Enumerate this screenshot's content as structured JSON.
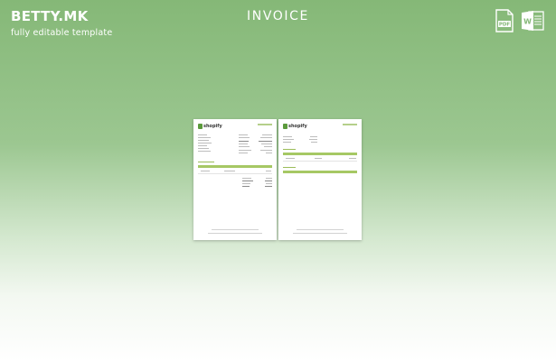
{
  "brand": {
    "name": "BETTY.MK",
    "tagline": "fully editable template"
  },
  "header": {
    "title": "INVOICE"
  },
  "formats": [
    {
      "icon": "pdf-file-icon",
      "label": "PDF"
    },
    {
      "icon": "word-file-icon",
      "label": "W"
    }
  ],
  "preview": {
    "pages": [
      {
        "logo_text": "shopify"
      },
      {
        "logo_text": "shopify"
      }
    ]
  },
  "colors": {
    "background_top": "#85b877",
    "background_bottom": "#ffffff",
    "accent_green": "#a6c864",
    "pdf_icon": "#ffffff",
    "word_icon": "#ffffff"
  }
}
